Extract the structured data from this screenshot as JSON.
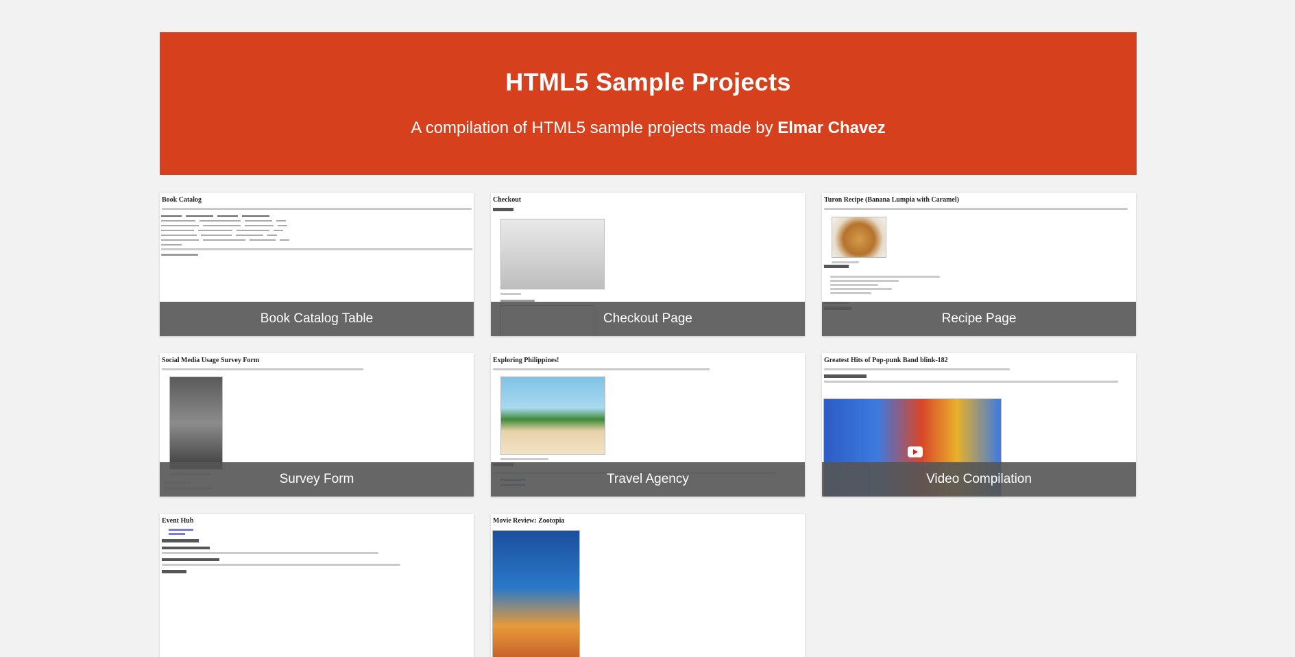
{
  "hero": {
    "title": "HTML5 Sample Projects",
    "subtitle_prefix": "A compilation of HTML5 sample projects made by",
    "author": "Elmar Chavez"
  },
  "colors": {
    "hero_background": "#d6401c",
    "caption_background": "#555555",
    "page_background": "#f2f2f2"
  },
  "projects": [
    {
      "caption": "Book Catalog Table",
      "preview_title": "Book Catalog"
    },
    {
      "caption": "Checkout Page",
      "preview_title": "Checkout"
    },
    {
      "caption": "Recipe Page",
      "preview_title": "Turon Recipe (Banana Lumpia with Caramel)"
    },
    {
      "caption": "Survey Form",
      "preview_title": "Social Media Usage Survey Form"
    },
    {
      "caption": "Travel Agency",
      "preview_title": "Exploring Philippines!"
    },
    {
      "caption": "Video Compilation",
      "preview_title": "Greatest Hits of Pop-punk Band blink-182"
    },
    {
      "caption": "",
      "preview_title": "Event Hub"
    },
    {
      "caption": "",
      "preview_title": "Movie Review: Zootopia"
    }
  ]
}
